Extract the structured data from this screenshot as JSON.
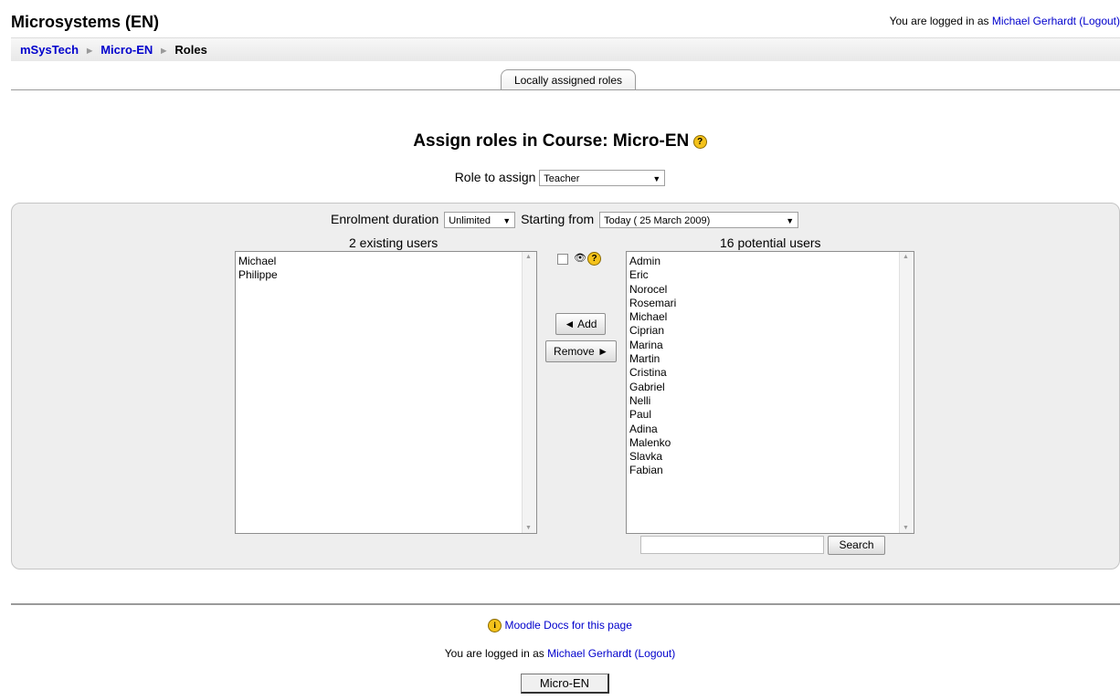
{
  "header": {
    "site_title": "Microsystems (EN)",
    "login_prefix": "You are logged in as",
    "user_name": "Michael Gerhardt",
    "logout": "(Logout)"
  },
  "breadcrumb": {
    "items": [
      "mSysTech",
      "Micro-EN",
      "Roles"
    ],
    "separator": "►"
  },
  "tabs": {
    "locally_assigned": "Locally assigned roles"
  },
  "main": {
    "heading": "Assign roles in Course: Micro-EN",
    "help_glyph": "?",
    "role_label": "Role to assign",
    "role_value": "Teacher"
  },
  "enrol": {
    "duration_label": "Enrolment duration",
    "duration_value": "Unlimited",
    "start_label": "Starting from",
    "start_value": "Today ( 25 March 2009)"
  },
  "existing": {
    "label": "2 existing users",
    "users": [
      "Michael",
      "Philippe"
    ]
  },
  "potential": {
    "label": "16 potential users",
    "users": [
      "Admin",
      "Eric",
      "Norocel",
      "Rosemari",
      "Michael",
      "Ciprian",
      "Marina",
      "Martin",
      "Cristina",
      "Gabriel",
      "Nelli",
      "Paul",
      "Adina",
      "Malenko",
      "Slavka",
      "Fabian"
    ]
  },
  "controls": {
    "eye_glyph": "👁",
    "add": "◄ Add",
    "remove": "Remove ►"
  },
  "search": {
    "value": "",
    "button": "Search"
  },
  "footer": {
    "docs_link": "Moodle Docs for this page",
    "info_glyph": "i",
    "login_prefix": "You are logged in as",
    "user_name": "Michael Gerhardt",
    "logout": "(Logout)",
    "course_button": "Micro-EN"
  },
  "colors": {
    "link": "#0000cc",
    "panel_bg": "#eeeeee",
    "help_icon": "#f4c21a"
  }
}
